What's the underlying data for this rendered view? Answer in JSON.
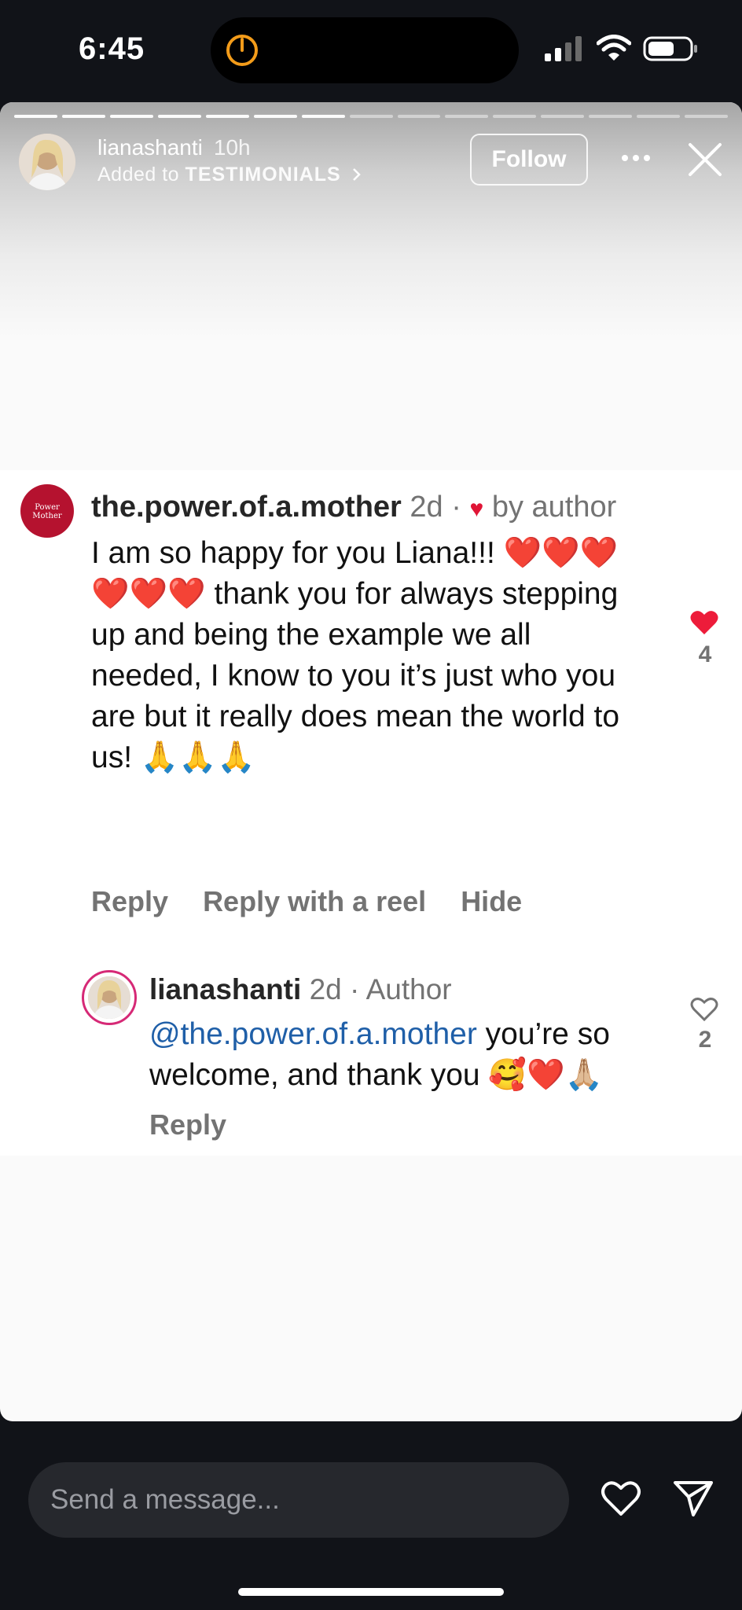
{
  "status_bar": {
    "time": "6:45"
  },
  "story": {
    "username": "lianashanti",
    "time_ago": "10h",
    "added_to_prefix": "Added to",
    "highlight_name": "TESTIMONIALS",
    "follow_label": "Follow",
    "progress": {
      "total_segments": 15,
      "completed_segments": 7
    }
  },
  "comment": {
    "avatar_text": "Power Mother",
    "username": "the.power.of.a.mother",
    "age": "2d",
    "liked_by": "by author",
    "text": "I am so happy for you Liana!!! ❤️❤️❤️❤️❤️❤️ thank you for always stepping up and being the example we all needed, I know to you it’s just who you are but it really does mean the world to us! 🙏🙏🙏",
    "actions": {
      "reply": "Reply",
      "reply_reel": "Reply with a reel",
      "hide": "Hide"
    },
    "likes": "4",
    "like_color": "#ed1c3a"
  },
  "reply": {
    "username": "lianashanti",
    "age": "2d",
    "role": "Author",
    "mention": "@the.power.of.a.mother",
    "text": " you’re so welcome, and thank you 🥰❤️🙏🏼",
    "reply_label": "Reply",
    "likes": "2"
  },
  "composer": {
    "placeholder": "Send a message..."
  },
  "icons": [
    "timer-icon",
    "signal-icon",
    "wifi-icon",
    "battery-icon",
    "more-icon",
    "close-icon",
    "heart-icon",
    "send-icon"
  ]
}
